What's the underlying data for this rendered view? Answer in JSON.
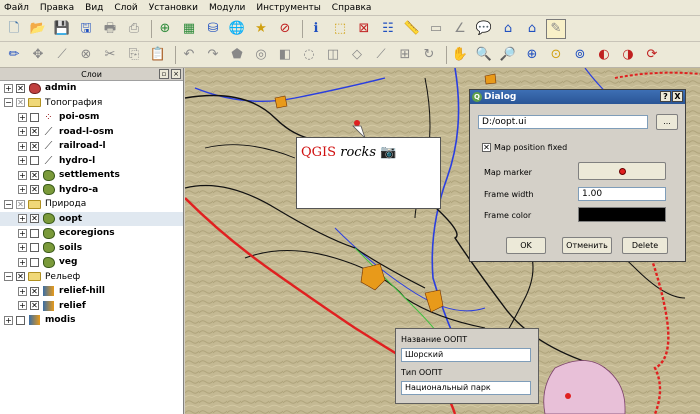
{
  "menu": [
    "Файл",
    "Правка",
    "Вид",
    "Слой",
    "Установки",
    "Модули",
    "Инструменты",
    "Справка"
  ],
  "layers_panel": {
    "title": "Слои",
    "layers": [
      {
        "name": "admin",
        "bold": true,
        "expand": "+",
        "check": "x",
        "icon": "polygon-red"
      },
      {
        "name": "Топография",
        "bold": false,
        "expand": "-",
        "check": "x-gray",
        "icon": "folder"
      },
      {
        "name": "poi-osm",
        "bold": true,
        "expand": "+",
        "check": "",
        "icon": "points"
      },
      {
        "name": "road-l-osm",
        "bold": true,
        "expand": "+",
        "check": "x",
        "icon": "line"
      },
      {
        "name": "railroad-l",
        "bold": true,
        "expand": "+",
        "check": "x",
        "icon": "line"
      },
      {
        "name": "hydro-l",
        "bold": true,
        "expand": "+",
        "check": "",
        "icon": "line"
      },
      {
        "name": "settlements",
        "bold": true,
        "expand": "+",
        "check": "x",
        "icon": "polygon"
      },
      {
        "name": "hydro-a",
        "bold": true,
        "expand": "+",
        "check": "x",
        "icon": "polygon"
      },
      {
        "name": "Природа",
        "bold": false,
        "expand": "-",
        "check": "x-gray",
        "icon": "folder"
      },
      {
        "name": "oopt",
        "bold": true,
        "expand": "+",
        "check": "x",
        "icon": "polygon",
        "selected": true
      },
      {
        "name": "ecoregions",
        "bold": true,
        "expand": "+",
        "check": "",
        "icon": "polygon"
      },
      {
        "name": "soils",
        "bold": true,
        "expand": "+",
        "check": "",
        "icon": "polygon"
      },
      {
        "name": "veg",
        "bold": true,
        "expand": "+",
        "check": "",
        "icon": "polygon"
      },
      {
        "name": "Рельеф",
        "bold": false,
        "expand": "-",
        "check": "x",
        "icon": "folder"
      },
      {
        "name": "relief-hill",
        "bold": true,
        "expand": "+",
        "check": "x",
        "icon": "raster"
      },
      {
        "name": "relief",
        "bold": true,
        "expand": "+",
        "check": "x",
        "icon": "raster"
      },
      {
        "name": "modis",
        "bold": true,
        "expand": "+",
        "check": "",
        "icon": "raster"
      }
    ]
  },
  "annotation": {
    "q": "QGIS",
    "rocks": "rocks",
    "icon": "camera-icon"
  },
  "dialog": {
    "title": "Dialog",
    "help_btn": "?",
    "close_btn": "X",
    "file_path": "D:/oopt.ui",
    "browse_btn": "...",
    "map_position_fixed": "Map position fixed",
    "map_marker_label": "Map marker",
    "frame_width_label": "Frame width",
    "frame_width_value": "1.00",
    "frame_color_label": "Frame color",
    "frame_color": "#000000",
    "ok": "OK",
    "cancel": "Отменить",
    "delete": "Delete"
  },
  "form": {
    "name_label": "Название ООПТ",
    "name_value": "Шорский",
    "type_label": "Тип ООПТ",
    "type_value": "Национальный парк"
  },
  "colors": {
    "boundary": "#e02020",
    "roads": "#111111",
    "rivers": "#2a3ee0",
    "settlements": "#e89a1a",
    "terrain": "#c9bf9a",
    "protected_area": "#e8c0d8"
  }
}
